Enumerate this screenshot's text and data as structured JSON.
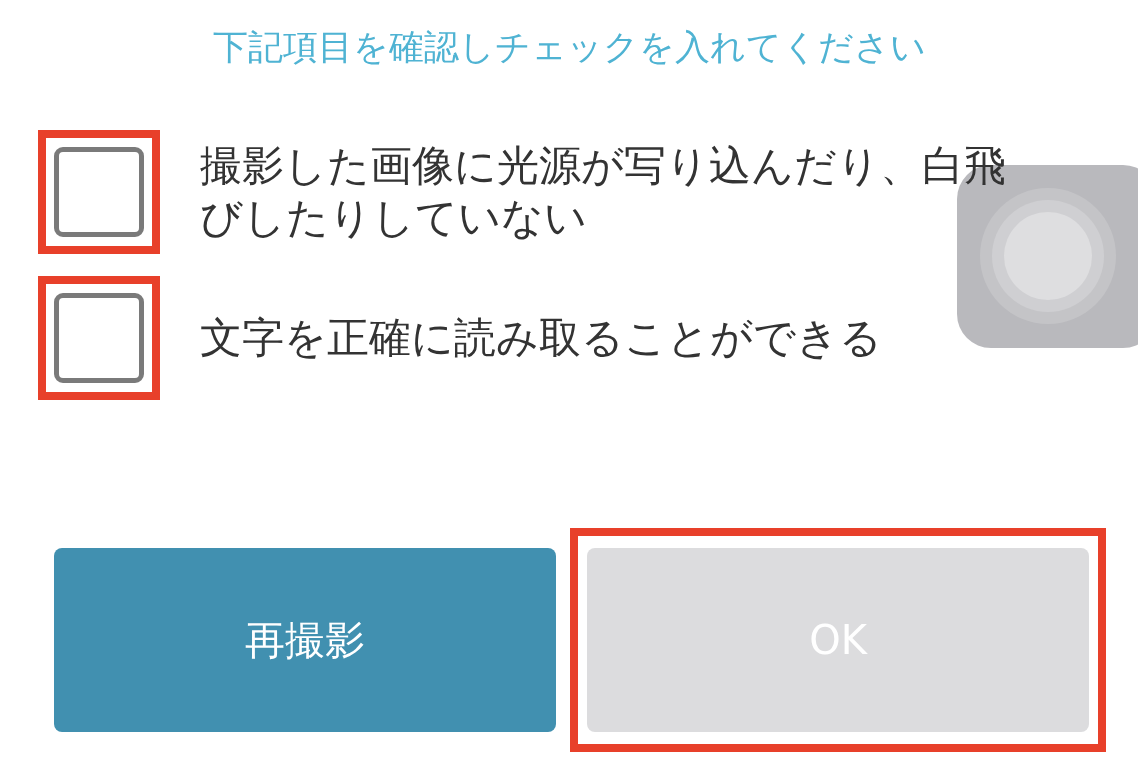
{
  "title": "下記項目を確認しチェックを入れてください",
  "items": [
    {
      "label": "撮影した画像に光源が写り込んだり、白飛びしたりしていない",
      "checked": false,
      "highlighted": true
    },
    {
      "label": "文字を正確に読み取ることができる",
      "checked": false,
      "highlighted": true
    }
  ],
  "buttons": [
    {
      "label": "再撮影",
      "kind": "primary",
      "disabled": false,
      "highlighted": false
    },
    {
      "label": "OK",
      "kind": "secondary",
      "disabled": true,
      "highlighted": true
    }
  ]
}
